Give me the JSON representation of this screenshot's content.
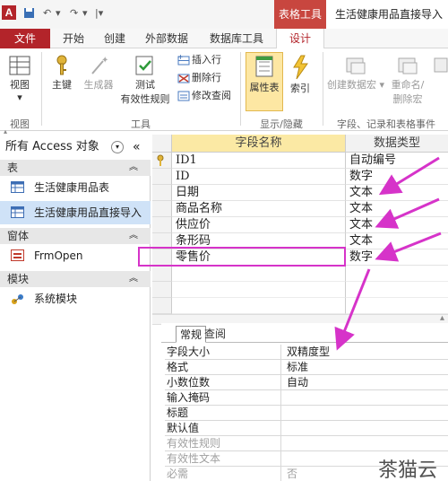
{
  "titlebar": {
    "app_icon": "A",
    "context_tab_group": "表格工具",
    "window_title": "生活健康用品直接导入"
  },
  "tabs": [
    "文件",
    "开始",
    "创建",
    "外部数据",
    "数据库工具",
    "设计"
  ],
  "ribbon": {
    "view_label": "视图",
    "primary_key_label": "主键",
    "builder_label": "生成器",
    "test_rules_label_1": "测试",
    "test_rules_label_2": "有效性规则",
    "insert_rows_label": "插入行",
    "delete_rows_label": "删除行",
    "modify_lookup_label": "修改查阅",
    "property_sheet_label": "属性表",
    "indexes_label": "索引",
    "create_data_macro_label": "创建数据宏",
    "rename_delete_macro_label_1": "重命名/",
    "rename_delete_macro_label_2": "删除宏",
    "group_views": "视图",
    "group_tools": "工具",
    "group_show_hide": "显示/隐藏",
    "group_field_record_table": "字段、记录和表格事件"
  },
  "navpane": {
    "header": "所有 Access 对象",
    "section_tables": "表",
    "tables": [
      "生活健康用品表",
      "生活健康用品直接导入"
    ],
    "section_forms": "窗体",
    "forms": [
      "FrmOpen"
    ],
    "section_modules": "模块",
    "modules": [
      "系统模块"
    ]
  },
  "grid": {
    "col_name": "字段名称",
    "col_type": "数据类型",
    "rows": [
      {
        "name": "ID1",
        "type": "自动编号",
        "key": true
      },
      {
        "name": "ID",
        "type": "数字"
      },
      {
        "name": "日期",
        "type": "文本"
      },
      {
        "name": "商品名称",
        "type": "文本"
      },
      {
        "name": "供应价",
        "type": "文本"
      },
      {
        "name": "条形码",
        "type": "文本"
      },
      {
        "name": "零售价",
        "type": "数字"
      }
    ]
  },
  "props": {
    "tab_general": "常规",
    "tab_lookup": "查阅",
    "rows": [
      {
        "label": "字段大小",
        "value": "双精度型"
      },
      {
        "label": "格式",
        "value": "标准"
      },
      {
        "label": "小数位数",
        "value": "自动"
      },
      {
        "label": "输入掩码",
        "value": ""
      },
      {
        "label": "标题",
        "value": ""
      },
      {
        "label": "默认值",
        "value": ""
      },
      {
        "label": "有效性规则",
        "value": "",
        "dim": true
      },
      {
        "label": "有效性文本",
        "value": "",
        "dim": true
      },
      {
        "label": "必需",
        "value": "否",
        "dim": true
      }
    ]
  },
  "watermark": "茶猫云",
  "colors": {
    "accent": "#b3242a",
    "annotation": "#d633c9",
    "property_sheet_active": "#fde7a3"
  }
}
